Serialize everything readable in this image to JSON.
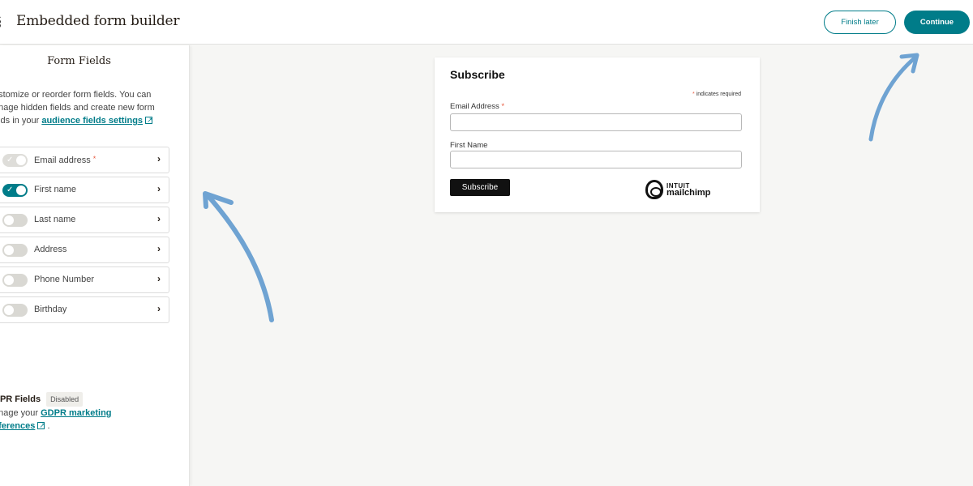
{
  "header": {
    "title": "Embedded form builder",
    "finish_later_label": "Finish later",
    "continue_label": "Continue",
    "accent_color": "#007c89"
  },
  "sidebar": {
    "title": "Form Fields",
    "description": "ustomize or reorder form fields. You can anage hidden fields and create new form elds in your",
    "description_lines": [
      "ustomize or reorder form fields. You can",
      "anage hidden fields and create new form",
      "elds in your"
    ],
    "settings_link": "audience fields settings",
    "fields": [
      {
        "label": "Email address",
        "required": true,
        "state": "locked-on"
      },
      {
        "label": "First name",
        "required": false,
        "state": "on"
      },
      {
        "label": "Last name",
        "required": false,
        "state": "off"
      },
      {
        "label": "Address",
        "required": false,
        "state": "off"
      },
      {
        "label": "Phone Number",
        "required": false,
        "state": "off"
      },
      {
        "label": "Birthday",
        "required": false,
        "state": "off"
      }
    ],
    "gdpr": {
      "title": "DPR Fields",
      "badge": "Disabled",
      "prefix": "anage your",
      "link_line1": "GDPR marketing",
      "link_line2": "eferences",
      "suffix": "."
    }
  },
  "preview": {
    "title": "Subscribe",
    "required_note": "indicates required",
    "star": "*",
    "fields": [
      {
        "label": "Email Address",
        "required": true,
        "value": ""
      },
      {
        "label": "First Name",
        "required": false,
        "value": ""
      }
    ],
    "submit_label": "Subscribe",
    "logo_top": "INTUIT",
    "logo_bottom": "mailchimp"
  },
  "annotations": {
    "arrow_color": "#6fa3d2"
  }
}
